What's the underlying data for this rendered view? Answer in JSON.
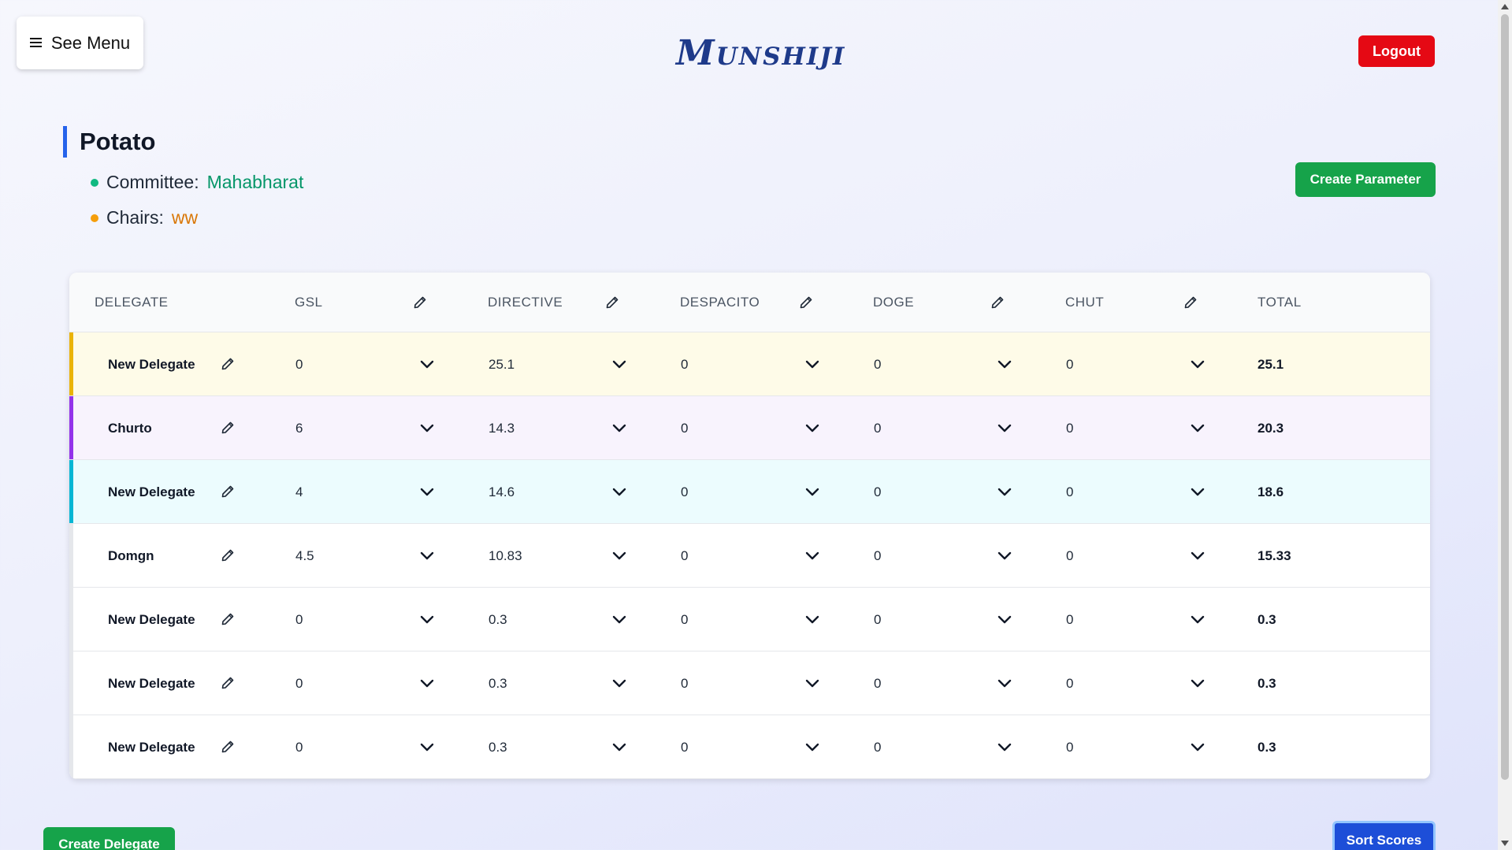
{
  "header": {
    "menu_label": "See Menu",
    "logo_text": "Munshiji",
    "logout_label": "Logout"
  },
  "session": {
    "title": "Potato",
    "committee_label": "Committee:",
    "committee_value": "Mahabharat",
    "chairs_label": "Chairs:",
    "chairs_value": "ww",
    "create_parameter_label": "Create Parameter"
  },
  "table": {
    "columns": [
      "Delegate",
      "GSL",
      "Directive",
      "Despacito",
      "Doge",
      "Chut",
      "Total"
    ],
    "rows": [
      {
        "name": "New Delegate",
        "scores": [
          "0",
          "25.1",
          "0",
          "0",
          "0"
        ],
        "total": "25.1",
        "accent": "#eab308",
        "bg": "#fefbe8"
      },
      {
        "name": "Churto",
        "scores": [
          "6",
          "14.3",
          "0",
          "0",
          "0"
        ],
        "total": "20.3",
        "accent": "#9333ea",
        "bg": "#f8f3fd"
      },
      {
        "name": "New Delegate",
        "scores": [
          "4",
          "14.6",
          "0",
          "0",
          "0"
        ],
        "total": "18.6",
        "accent": "#06b6d4",
        "bg": "#ecfcfe"
      },
      {
        "name": "Domgn",
        "scores": [
          "4.5",
          "10.83",
          "0",
          "0",
          "0"
        ],
        "total": "15.33",
        "accent": "#e5e7eb",
        "bg": "#ffffff"
      },
      {
        "name": "New Delegate",
        "scores": [
          "0",
          "0.3",
          "0",
          "0",
          "0"
        ],
        "total": "0.3",
        "accent": "#e5e7eb",
        "bg": "#ffffff"
      },
      {
        "name": "New Delegate",
        "scores": [
          "0",
          "0.3",
          "0",
          "0",
          "0"
        ],
        "total": "0.3",
        "accent": "#e5e7eb",
        "bg": "#ffffff"
      },
      {
        "name": "New Delegate",
        "scores": [
          "0",
          "0.3",
          "0",
          "0",
          "0"
        ],
        "total": "0.3",
        "accent": "#e5e7eb",
        "bg": "#ffffff"
      }
    ]
  },
  "footer": {
    "create_delegate_label": "Create Delegate",
    "sort_scores_label": "Sort Scores"
  },
  "colors": {
    "primary_green": "#16a34a",
    "logout_red": "#e50914",
    "sort_blue": "#1d4ed8",
    "heading_accent": "#2563eb"
  }
}
